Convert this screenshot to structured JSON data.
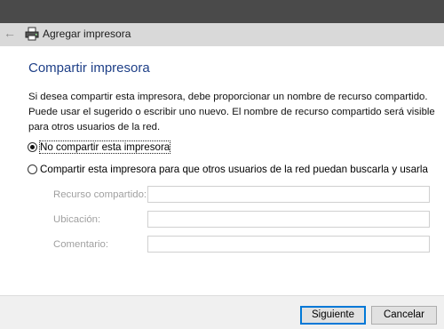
{
  "window": {
    "title": "Agregar impresora"
  },
  "heading": "Compartir impresora",
  "description": "Si desea compartir esta impresora, debe proporcionar un nombre de recurso compartido. Puede usar el sugerido o escribir uno nuevo. El nombre de recurso compartido será visible para otros usuarios de la red.",
  "options": [
    {
      "label": "No compartir esta impresora",
      "selected": true
    },
    {
      "label": "Compartir esta impresora para que otros usuarios de la red puedan buscarla y usarla",
      "selected": false
    }
  ],
  "fields": {
    "share_name": {
      "label": "Recurso compartido:",
      "value": ""
    },
    "location": {
      "label": "Ubicación:",
      "value": ""
    },
    "comment": {
      "label": "Comentario:",
      "value": ""
    }
  },
  "buttons": {
    "next": "Siguiente",
    "cancel": "Cancelar"
  },
  "icons": {
    "back": "arrow-left-icon",
    "printer": "printer-icon"
  },
  "colors": {
    "heading": "#1e3f87",
    "accent": "#0078d7"
  }
}
